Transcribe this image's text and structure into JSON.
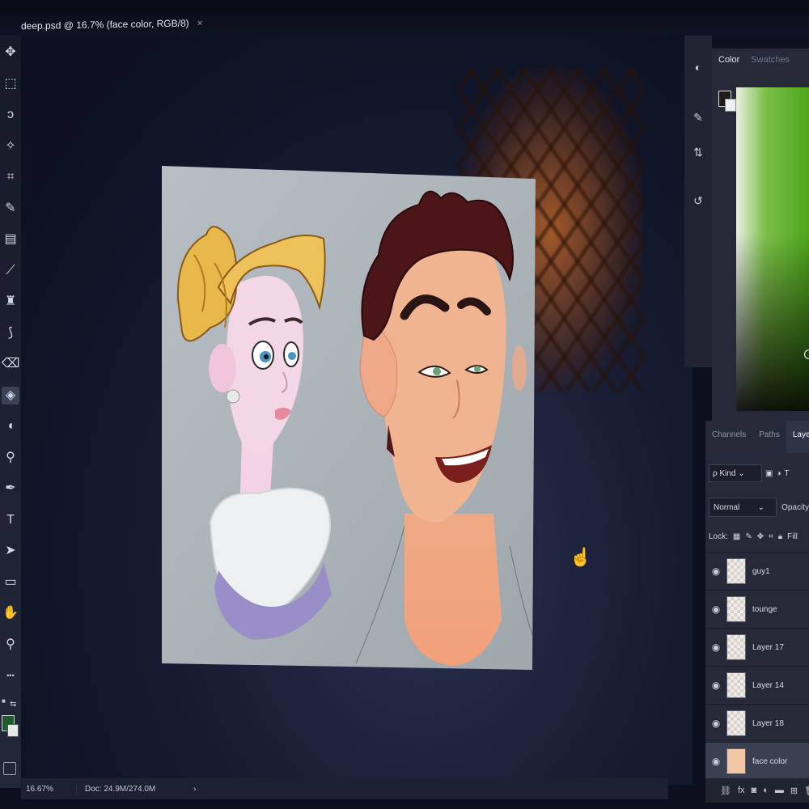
{
  "document": {
    "tab_title": "deep.psd @ 16.7% (face color, RGB/8)",
    "close_label": "×"
  },
  "toolbar": {
    "tools": [
      {
        "name": "move-tool",
        "icon": "move-icon",
        "glyph": "✥"
      },
      {
        "name": "marquee-tool",
        "icon": "marquee-icon",
        "glyph": "⬚"
      },
      {
        "name": "lasso-tool",
        "icon": "lasso-icon",
        "glyph": "ↄ"
      },
      {
        "name": "magic-wand-tool",
        "icon": "magic-wand-icon",
        "glyph": "✧"
      },
      {
        "name": "crop-tool",
        "icon": "crop-icon",
        "glyph": "⌗"
      },
      {
        "name": "eyedropper-tool",
        "icon": "eyedropper-icon",
        "glyph": "✎"
      },
      {
        "name": "healing-brush-tool",
        "icon": "bandage-icon",
        "glyph": "▤"
      },
      {
        "name": "brush-tool",
        "icon": "brush-icon",
        "glyph": "⟋"
      },
      {
        "name": "clone-stamp-tool",
        "icon": "stamp-icon",
        "glyph": "♜"
      },
      {
        "name": "history-brush-tool",
        "icon": "history-brush-icon",
        "glyph": "⟆"
      },
      {
        "name": "eraser-tool",
        "icon": "eraser-icon",
        "glyph": "⌫"
      },
      {
        "name": "paint-bucket-tool",
        "icon": "paint-bucket-icon",
        "glyph": "◈"
      },
      {
        "name": "blur-tool",
        "icon": "drop-icon",
        "glyph": "◖"
      },
      {
        "name": "dodge-tool",
        "icon": "dodge-icon",
        "glyph": "⚲"
      },
      {
        "name": "pen-tool",
        "icon": "pen-icon",
        "glyph": "✒"
      },
      {
        "name": "type-tool",
        "icon": "type-icon",
        "glyph": "T"
      },
      {
        "name": "path-selection-tool",
        "icon": "arrow-cursor-icon",
        "glyph": "➤"
      },
      {
        "name": "rectangle-tool",
        "icon": "rectangle-icon",
        "glyph": "▭"
      },
      {
        "name": "hand-tool",
        "icon": "hand-icon",
        "glyph": "✋"
      },
      {
        "name": "zoom-tool",
        "icon": "zoom-icon",
        "glyph": "⚲"
      },
      {
        "name": "more-tools",
        "icon": "ellipsis-icon",
        "glyph": "•••"
      }
    ],
    "foreground_color": "#1f5a2a",
    "background_color": "#e8e8e8"
  },
  "status": {
    "zoom": "16.67%",
    "doc": "Doc: 24.9M/274.0M",
    "arrow": "›"
  },
  "color_panel": {
    "tab_color": "Color",
    "tab_swatches": "Swatches"
  },
  "layers_panel": {
    "tabs": [
      "Channels",
      "Paths",
      "Layers"
    ],
    "kind_label": "ρ Kind",
    "blend_mode": "Normal",
    "opacity_label": "Opacity",
    "lock_label": "Lock:",
    "fill_label": "Fill",
    "layers": [
      {
        "name": "guy1",
        "visible": true,
        "selected": false
      },
      {
        "name": "tounge",
        "visible": true,
        "selected": false
      },
      {
        "name": "Layer 17",
        "visible": true,
        "selected": false
      },
      {
        "name": "Layer 14",
        "visible": true,
        "selected": false
      },
      {
        "name": "Layer 18",
        "visible": true,
        "selected": false
      },
      {
        "name": "face color",
        "visible": true,
        "selected": true
      }
    ]
  },
  "colors": {
    "canvas_bg": "#a9b0b6",
    "hair_blonde": "#e6b43c",
    "hair_brown": "#4a1416",
    "skin_girl": "#f3d6e6",
    "skin_guy": "#f0b08a"
  }
}
